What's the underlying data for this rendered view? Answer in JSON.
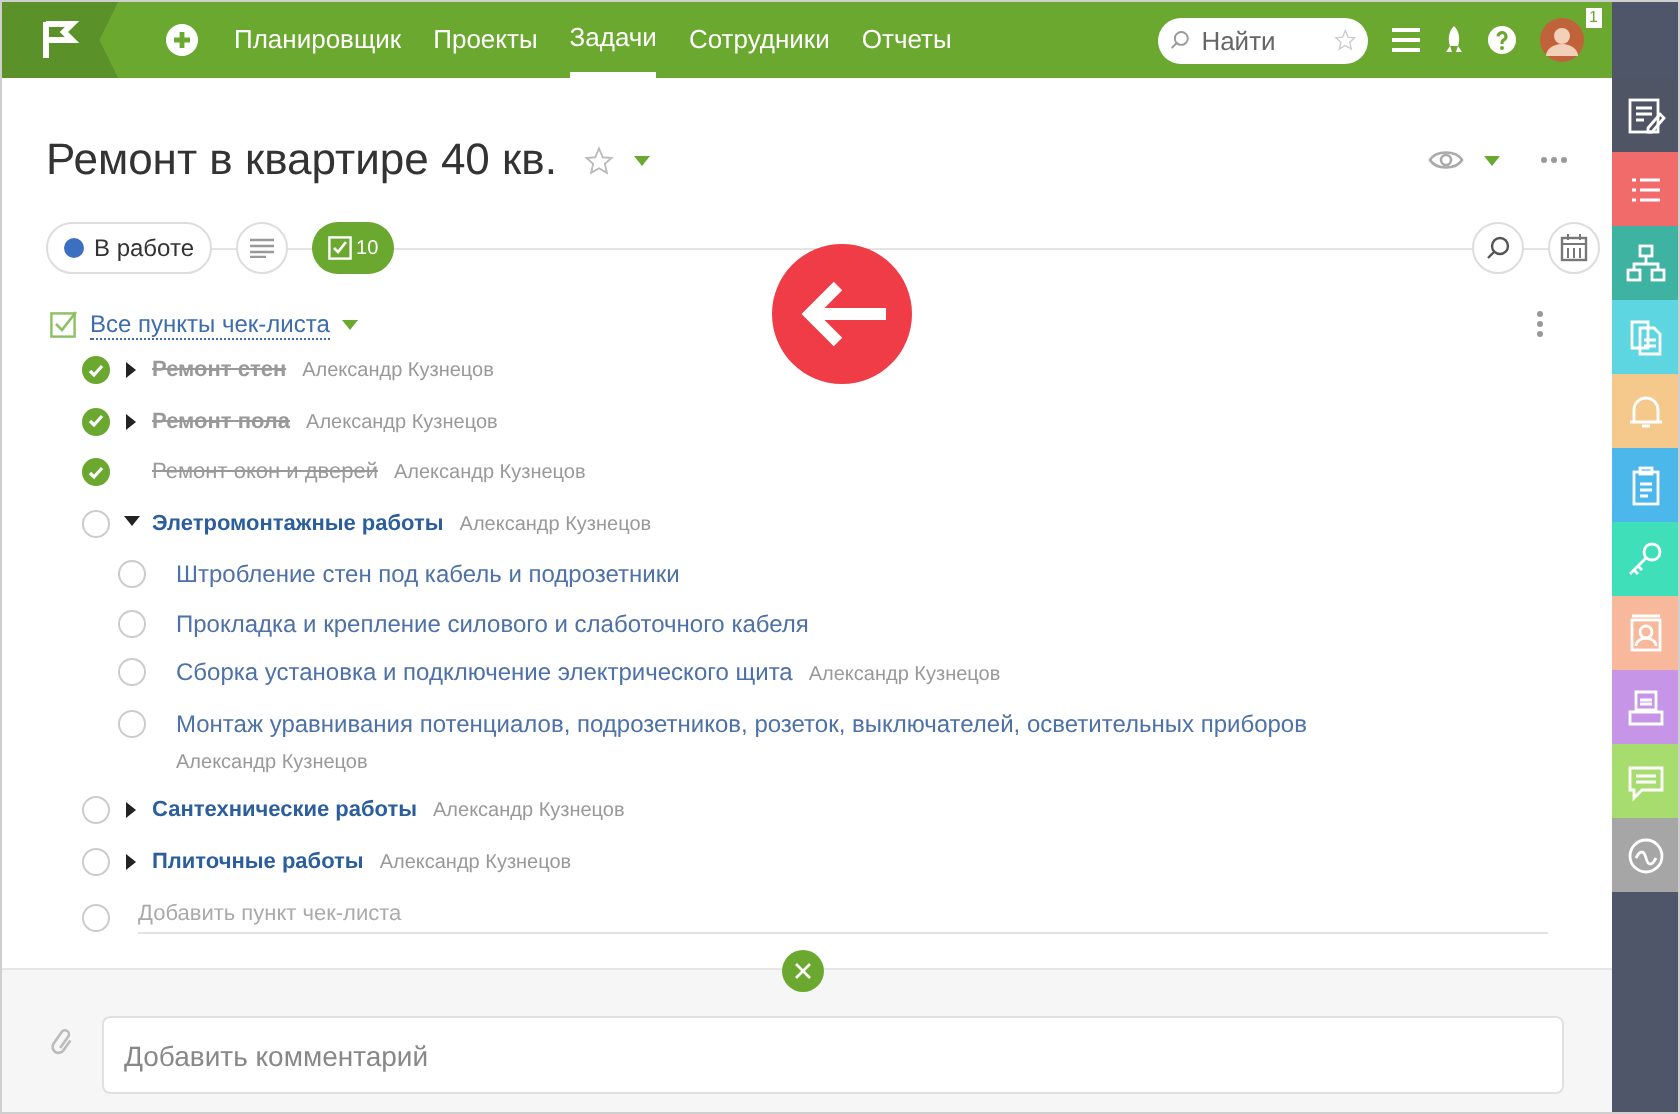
{
  "nav": {
    "items": [
      {
        "label": "Планировщик",
        "selected": false
      },
      {
        "label": "Проекты",
        "selected": false
      },
      {
        "label": "Задачи",
        "selected": true
      },
      {
        "label": "Сотрудники",
        "selected": false
      },
      {
        "label": "Отчеты",
        "selected": false
      }
    ],
    "search": {
      "placeholder": "Найти"
    },
    "avatar_badge": "1"
  },
  "task": {
    "title": "Ремонт в квартире 40 кв.",
    "status": "В работе",
    "checklist_count": "10"
  },
  "checklist": {
    "header": "Все пункты чек-листа",
    "items": [
      {
        "kind": "group",
        "text": "Ремонт стен",
        "author": "Александр Кузнецов",
        "checked": true,
        "expanded": false
      },
      {
        "kind": "group",
        "text": "Ремонт пола",
        "author": "Александр Кузнецов",
        "checked": true,
        "expanded": false
      },
      {
        "kind": "task",
        "text": "Ремонт окон и дверей",
        "author": "Александр Кузнецов",
        "checked": true
      },
      {
        "kind": "group",
        "text": "Элетромонтажные работы",
        "author": "Александр Кузнецов",
        "checked": false,
        "expanded": true,
        "children": [
          {
            "text": "Штробление стен под кабель и подрозетники",
            "checked": false
          },
          {
            "text": "Прокладка и крепление силового и слаботочного кабеля",
            "checked": false
          },
          {
            "text": "Сборка установка и подключение электрического щита",
            "author": "Александр Кузнецов",
            "checked": false
          },
          {
            "text": "Монтаж уравнивания потенциалов, подрозетников, розеток, выключателей, осветительных приборов",
            "author": "Александр Кузнецов",
            "checked": false
          }
        ]
      },
      {
        "kind": "group",
        "text": "Сантехнические работы",
        "author": "Александр Кузнецов",
        "checked": false,
        "expanded": false
      },
      {
        "kind": "group",
        "text": "Плиточные работы",
        "author": "Александр Кузнецов",
        "checked": false,
        "expanded": false
      }
    ],
    "add_placeholder": "Добавить пункт чек-листа"
  },
  "comment": {
    "placeholder": "Добавить комментарий"
  },
  "sidebar": {
    "items": [
      {
        "kind": "notes",
        "color": "#505566"
      },
      {
        "kind": "list",
        "color": "#f26b6b"
      },
      {
        "kind": "hierarchy",
        "color": "#3fb3a2"
      },
      {
        "kind": "documents",
        "color": "#5dd6e2"
      },
      {
        "kind": "bell",
        "color": "#f5c98c"
      },
      {
        "kind": "clipboard",
        "color": "#4cb7ea"
      },
      {
        "kind": "key",
        "color": "#3fe0b9"
      },
      {
        "kind": "contact",
        "color": "#f8b89c"
      },
      {
        "kind": "inbox",
        "color": "#c795e8"
      },
      {
        "kind": "chat",
        "color": "#a7dc6f"
      },
      {
        "kind": "wave",
        "color": "#a6a6a6"
      }
    ]
  }
}
